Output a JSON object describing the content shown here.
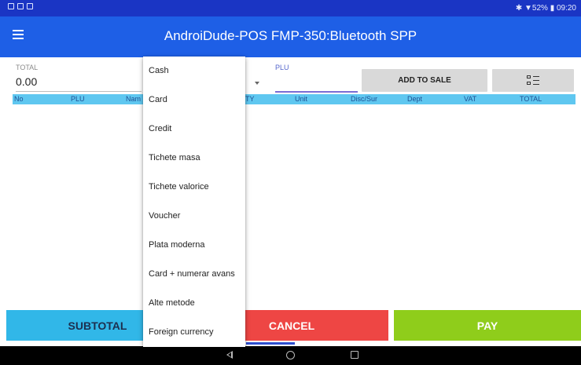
{
  "app": {
    "title": "AndroiDude-POS   FMP-350:Bluetooth SPP"
  },
  "statusbar": {
    "right_text": "✱ ▼52% ▮ 09:20"
  },
  "totals": {
    "total_label": "TOTAL",
    "total_value": "0.00"
  },
  "plu": {
    "label": "PLU",
    "value": ""
  },
  "buttons": {
    "add_to_sale": "ADD TO SALE",
    "subtotal": "SUBTOTAL",
    "cancel": "CANCEL",
    "pay": "PAY"
  },
  "table": {
    "columns": [
      "No",
      "PLU",
      "Nam",
      "TY",
      "Unit",
      "Disc/Sur",
      "Dept",
      "VAT",
      "TOTAL"
    ]
  },
  "payment_menu": {
    "items": [
      "Cash",
      "Card",
      "Credit",
      "Tichete masa",
      "Tichete valorice",
      "Voucher",
      "Plata moderna",
      "Card + numerar avans",
      "Alte metode",
      "Foreign currency"
    ]
  },
  "icons": {
    "menu": "hamburger-menu-icon",
    "list": "checklist-icon",
    "back": "back-icon",
    "home": "home-icon",
    "recent": "recent-apps-icon"
  },
  "colors": {
    "appbar": "#1e5fe6",
    "statusbar": "#1a35c4",
    "subtotal": "#31b7e8",
    "cancel": "#ee4644",
    "pay": "#8fcd1b",
    "table_header": "#5fc7f0"
  }
}
